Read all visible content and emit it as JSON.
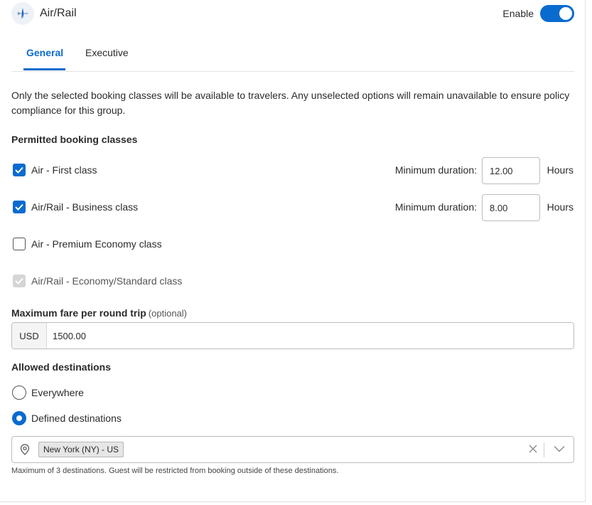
{
  "header": {
    "title": "Air/Rail",
    "enable_label": "Enable",
    "enabled": true,
    "icon": "plane-icon"
  },
  "tabs": [
    {
      "label": "General",
      "active": true
    },
    {
      "label": "Executive",
      "active": false
    }
  ],
  "intro": "Only the selected booking classes will be available to travelers. Any unselected options will remain unavailable to ensure policy compliance for this group.",
  "booking": {
    "heading": "Permitted booking classes",
    "classes": [
      {
        "label": "Air - First class",
        "state": "checked",
        "min_label": "Minimum duration:",
        "duration": "12.00",
        "unit": "Hours"
      },
      {
        "label": "Air/Rail - Business class",
        "state": "checked",
        "min_label": "Minimum duration:",
        "duration": "8.00",
        "unit": "Hours"
      },
      {
        "label": "Air - Premium Economy class",
        "state": "unchecked"
      },
      {
        "label": "Air/Rail - Economy/Standard class",
        "state": "disabled-checked"
      }
    ]
  },
  "fare": {
    "heading": "Maximum fare per round trip",
    "optional": "(optional)",
    "currency": "USD",
    "value": "1500.00"
  },
  "destinations": {
    "heading": "Allowed destinations",
    "options": [
      {
        "label": "Everywhere",
        "selected": false
      },
      {
        "label": "Defined destinations",
        "selected": true
      }
    ],
    "chip": "New York (NY) - US",
    "hint": "Maximum of 3 destinations. Guest will be restricted from booking outside of these destinations."
  },
  "colors": {
    "accent": "#0a6bcf",
    "border": "#bdbdbd",
    "disabled": "#d5d5d5"
  }
}
